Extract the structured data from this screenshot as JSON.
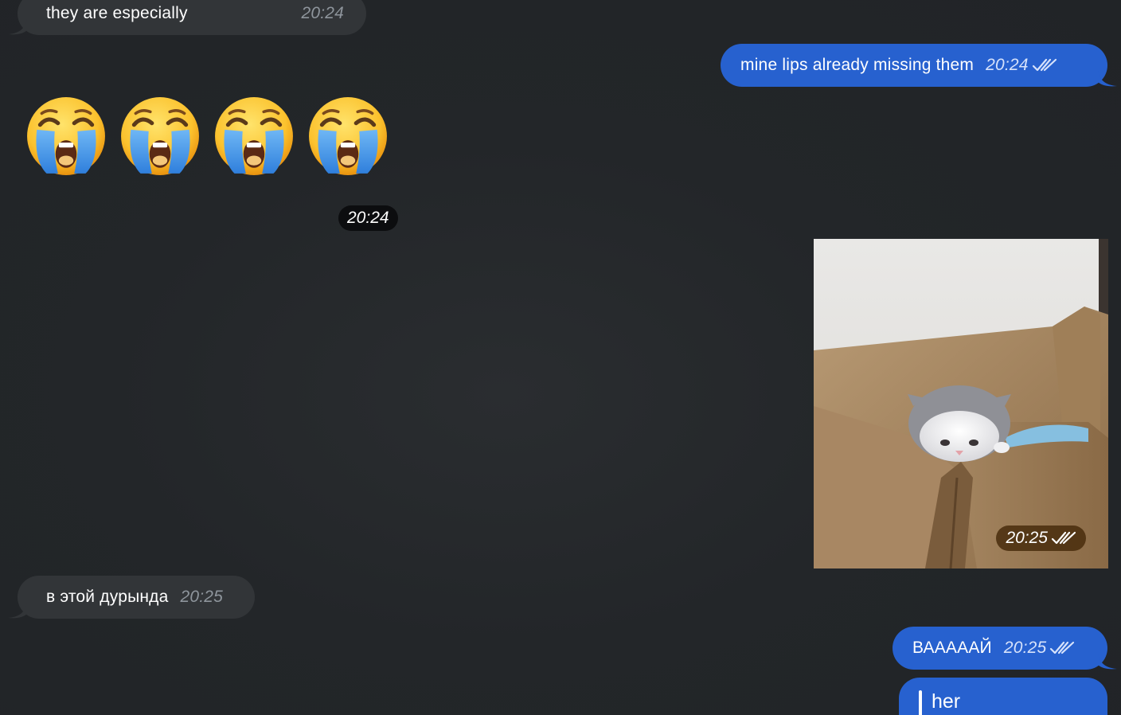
{
  "messages": {
    "m1": {
      "text": "they are especially",
      "time": "20:24",
      "direction": "incoming"
    },
    "m2": {
      "text": "mine lips already missing them",
      "time": "20:24",
      "direction": "outgoing",
      "status": "read"
    },
    "m3": {
      "emoji": "loudly-crying-face",
      "count": 4,
      "time": "20:24",
      "direction": "incoming"
    },
    "m4": {
      "type": "photo",
      "subject": "kitten in cardboard box",
      "time": "20:25",
      "direction": "outgoing",
      "status": "read"
    },
    "m5": {
      "text": "в этой дурында",
      "time": "20:25",
      "direction": "incoming"
    },
    "m6": {
      "text": "ВААААAЙ",
      "time": "20:25",
      "direction": "outgoing",
      "status": "read"
    },
    "m7": {
      "text": "her",
      "direction": "outgoing"
    }
  },
  "colors": {
    "background": "#222528",
    "incoming_bubble": "#323538",
    "outgoing_bubble": "#2761cf",
    "time_pill": "#0c0d0f"
  },
  "icons": {
    "read_status": "double-check-icon",
    "emoji": "loudly-crying-face-emoji"
  }
}
